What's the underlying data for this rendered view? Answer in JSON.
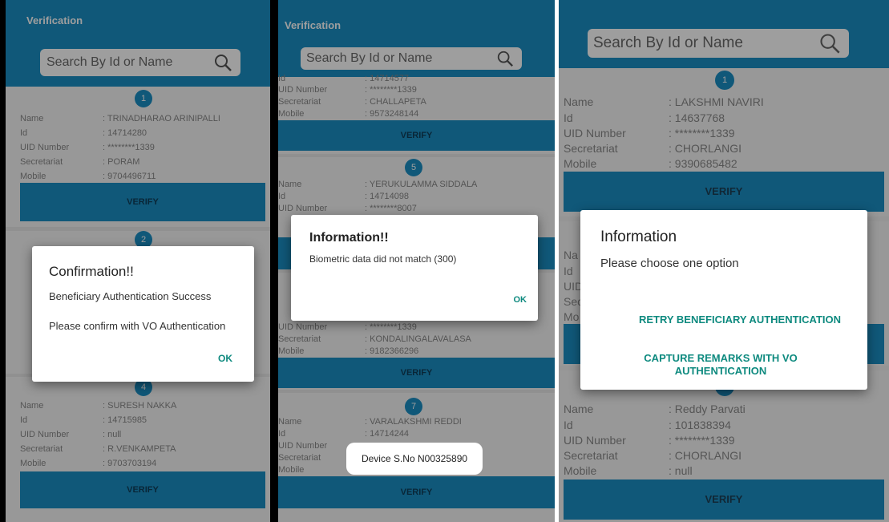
{
  "panel1": {
    "title": "Verification",
    "search_placeholder": "Search By Id or Name",
    "labels": {
      "name": "Name",
      "id": "Id",
      "uid": "UID Number",
      "secretariat": "Secretariat",
      "mobile": "Mobile"
    },
    "cards": [
      {
        "badge": "1",
        "name": ": TRINADHARAO ARINIPALLI",
        "id": ": 14714280",
        "uid": ": ********1339",
        "secretariat": ": PORAM",
        "mobile": ": 9704496711",
        "verify": "VERIFY"
      },
      {
        "badge": "2"
      },
      {
        "badge": "4",
        "name": ": SURESH NAKKA",
        "id": ": 14715985",
        "uid": ": null",
        "secretariat": ": R.VENKAMPETA",
        "mobile": ": 9703703194",
        "verify": "VERIFY"
      }
    ],
    "dialog": {
      "title": "Confirmation!!",
      "message1": "Beneficiary Authentication Success",
      "message2": "Please confirm with VO Authentication",
      "ok": "OK"
    }
  },
  "panel2": {
    "title": "Verification",
    "search_placeholder": "Search By Id or Name",
    "labels": {
      "name": "Name",
      "id": "Id",
      "uid": "UID Number",
      "secretariat": "Secretariat",
      "mobile": "Mobile"
    },
    "cards": [
      {
        "id": ": 14714577",
        "uid": ": ********1339",
        "secretariat": ": CHALLAPETA",
        "mobile": ": 9573248144",
        "verify": "VERIFY"
      },
      {
        "badge": "5",
        "name": ": YERUKULAMMA SIDDALA",
        "id": ": 14714098",
        "uid": ": ********8007"
      },
      {
        "uid": ": ********1339",
        "secretariat": ": KONDALINGALAVALASA",
        "mobile": ": 9182366296",
        "verify": "VERIFY"
      },
      {
        "badge": "7",
        "name": ": VARALAKSHMI REDDI",
        "id": ": 14714244",
        "verify": "VERIFY"
      }
    ],
    "dialog": {
      "title": "Information!!",
      "message": "Biometric data did not match (300)",
      "ok": "OK"
    },
    "toast": "Device S.No N00325890"
  },
  "panel3": {
    "search_placeholder": "Search By Id or Name",
    "labels": {
      "name": "Name",
      "id": "Id",
      "uid": "UID Number",
      "secretariat": "Secretariat",
      "mobile": "Mobile"
    },
    "cards": [
      {
        "badge": "1",
        "name": ": LAKSHMI NAVIRI",
        "id": ": 14637768",
        "uid": ": ********1339",
        "secretariat": ": CHORLANGI",
        "mobile": ": 9390685482",
        "verify": "VERIFY"
      },
      {
        "name": ": Reddy Parvati",
        "id": ": 101838394",
        "uid": ": ********1339",
        "secretariat": ": CHORLANGI",
        "mobile": ": null",
        "verify": "VERIFY"
      }
    ],
    "partial_labels": [
      "Na",
      "Id",
      "UID",
      "Sec",
      "Mo"
    ],
    "dialog": {
      "title": "Information",
      "message": "Please choose one option",
      "option1": "RETRY BENEFICIARY AUTHENTICATION",
      "option2": "CAPTURE REMARKS WITH VO AUTHENTICATION"
    }
  },
  "colors": {
    "header": "#1a8fc4",
    "accent": "#0e8a7f"
  }
}
